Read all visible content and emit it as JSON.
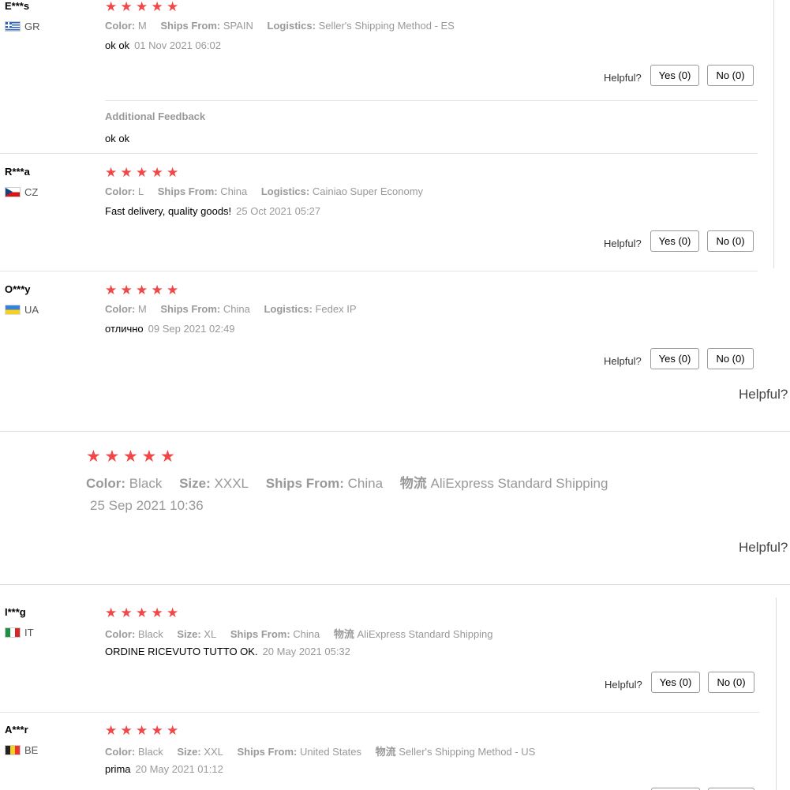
{
  "reviews": [
    {
      "user": "E***s",
      "country": "GR",
      "meta": [
        {
          "k": "Color:",
          "v": "M"
        },
        {
          "k": "Ships From:",
          "v": "SPAIN"
        },
        {
          "k": "Logistics:",
          "v": "Seller's Shipping Method - ES"
        }
      ],
      "text": "ok ok",
      "date": "01 Nov 2021 06:02",
      "helpful": "Helpful?",
      "yes": "Yes (0)",
      "no": "No (0)",
      "additional_title": "Additional Feedback",
      "additional_text": "ok ok"
    },
    {
      "user": "R***a",
      "country": "CZ",
      "meta": [
        {
          "k": "Color:",
          "v": "L"
        },
        {
          "k": "Ships From:",
          "v": "China"
        },
        {
          "k": "Logistics:",
          "v": "Cainiao Super Economy"
        }
      ],
      "text": "Fast delivery, quality goods!",
      "date": "25 Oct 2021 05:27",
      "helpful": "Helpful?",
      "yes": "Yes (0)",
      "no": "No (0)"
    },
    {
      "user": "O***y",
      "country": "UA",
      "meta": [
        {
          "k": "Color:",
          "v": "M"
        },
        {
          "k": "Ships From:",
          "v": "China"
        },
        {
          "k": "Logistics:",
          "v": "Fedex IP"
        }
      ],
      "text": "отлично",
      "date": "09 Sep 2021 02:49",
      "helpful": "Helpful?",
      "yes": "Yes (0)",
      "no": "No (0)"
    },
    {
      "meta": [
        {
          "k": "Color:",
          "v": "Black"
        },
        {
          "k": "Size:",
          "v": "XXXL"
        },
        {
          "k": "Ships From:",
          "v": "China"
        },
        {
          "k": "物流",
          "v": "AliExpress Standard Shipping"
        }
      ],
      "date": "25 Sep 2021 10:36",
      "helpful_top": "Helpful?",
      "helpful_bottom": "Helpful?"
    },
    {
      "user": "I***g",
      "country": "IT",
      "meta": [
        {
          "k": "Color:",
          "v": "Black"
        },
        {
          "k": "Size:",
          "v": "XL"
        },
        {
          "k": "Ships From:",
          "v": "China"
        },
        {
          "k": "物流",
          "v": "AliExpress Standard Shipping"
        }
      ],
      "text": "ORDINE RICEVUTO TUTTO OK.",
      "date": "20 May 2021 05:32",
      "helpful": "Helpful?",
      "yes": "Yes (0)",
      "no": "No (0)"
    },
    {
      "user": "A***r",
      "country": "BE",
      "meta": [
        {
          "k": "Color:",
          "v": "Black"
        },
        {
          "k": "Size:",
          "v": "XXL"
        },
        {
          "k": "Ships From:",
          "v": "United States"
        },
        {
          "k": "物流",
          "v": "Seller's Shipping Method - US"
        }
      ],
      "text": "prima",
      "date": "20 May 2021 01:12"
    }
  ],
  "rating": 5
}
